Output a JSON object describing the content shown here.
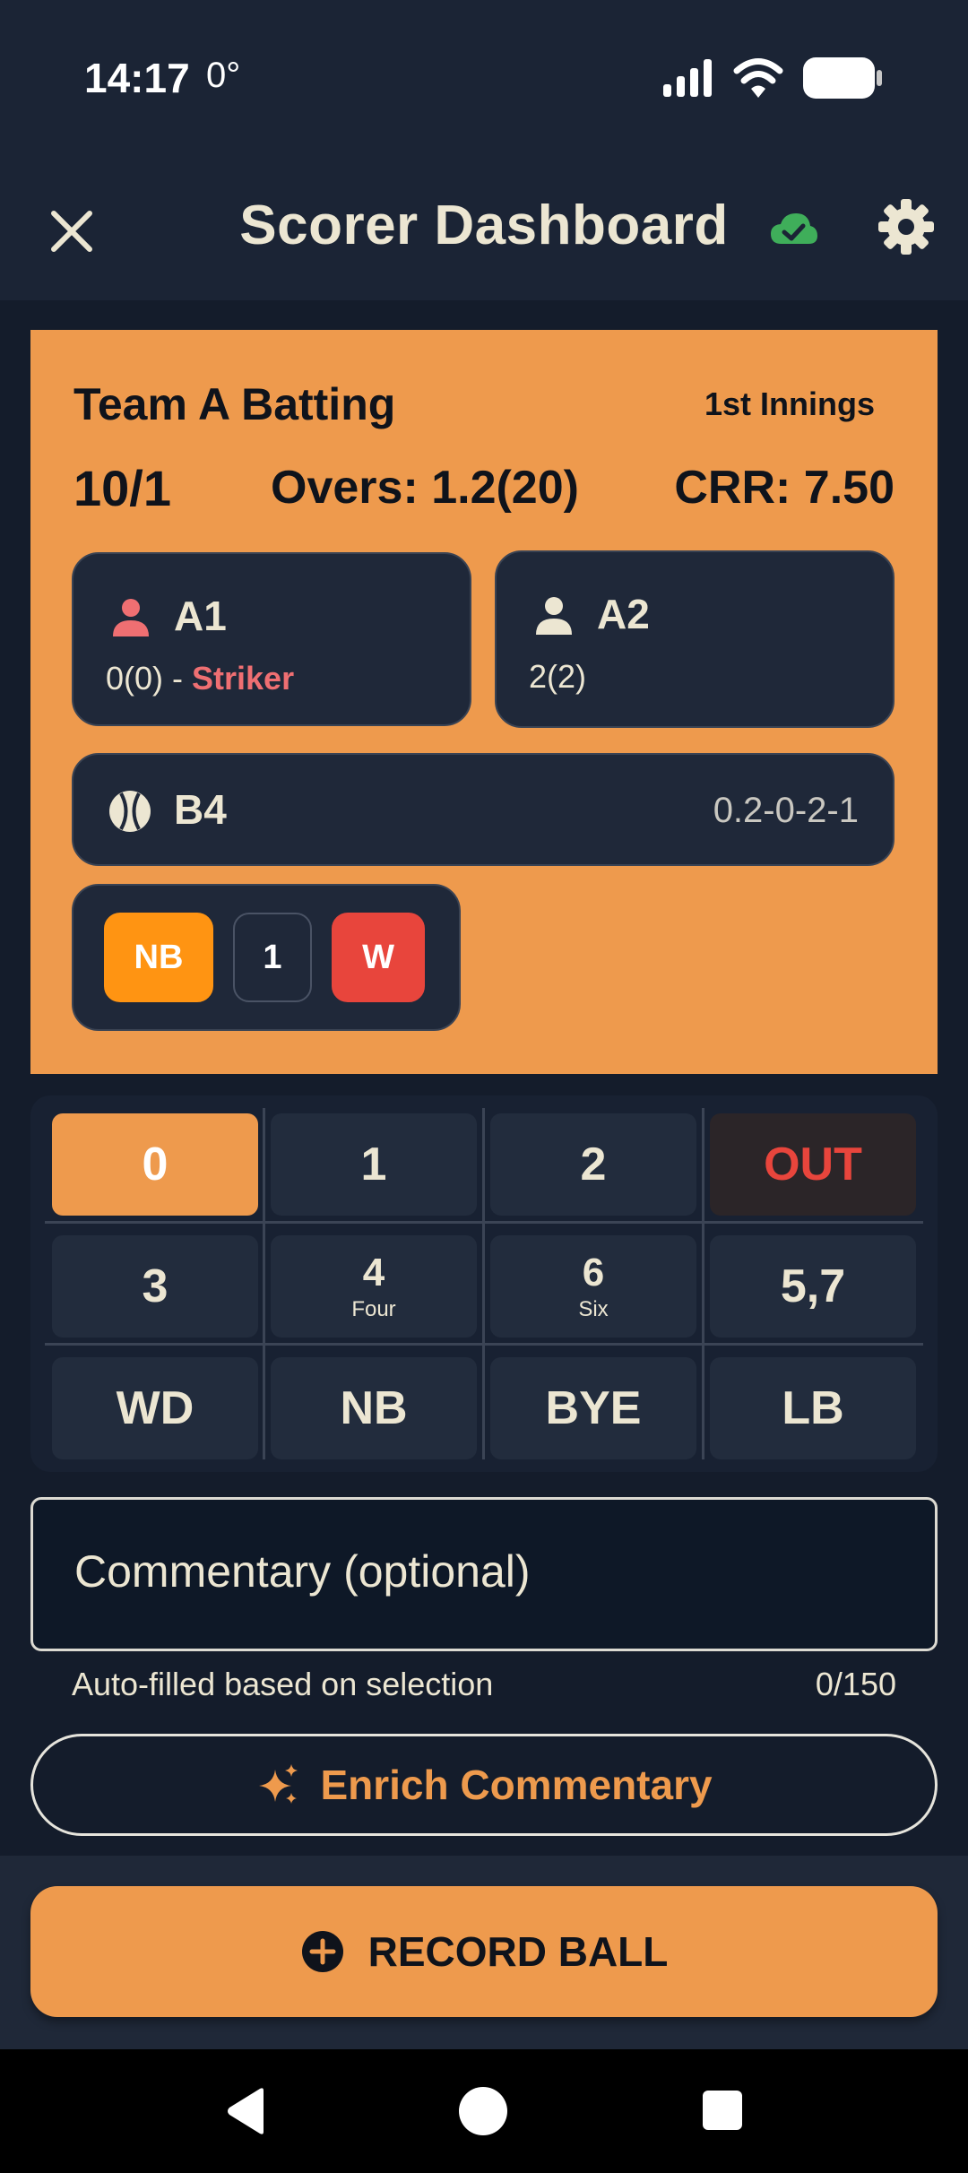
{
  "status": {
    "time": "14:17",
    "temperature": "0°"
  },
  "appbar": {
    "title": "Scorer Dashboard"
  },
  "scorecard": {
    "team_title": "Team A Batting",
    "innings": "1st Innings",
    "score": "10/1",
    "overs": "Overs: 1.2(20)",
    "crr": "CRR: 7.50",
    "batter1": {
      "name": "A1",
      "stat": "0(0) - ",
      "role": "Striker"
    },
    "batter2": {
      "name": "A2",
      "stat": "2(2)"
    },
    "bowler": {
      "name": "B4",
      "figures": "0.2-0-2-1"
    },
    "extras": [
      "NB",
      "1",
      "W"
    ]
  },
  "pad": {
    "keys": [
      {
        "label": "0",
        "sub": ""
      },
      {
        "label": "1",
        "sub": ""
      },
      {
        "label": "2",
        "sub": ""
      },
      {
        "label": "OUT",
        "sub": ""
      },
      {
        "label": "3",
        "sub": ""
      },
      {
        "label": "4",
        "sub": "Four"
      },
      {
        "label": "6",
        "sub": "Six"
      },
      {
        "label": "5,7",
        "sub": ""
      },
      {
        "label": "WD",
        "sub": ""
      },
      {
        "label": "NB",
        "sub": ""
      },
      {
        "label": "BYE",
        "sub": ""
      },
      {
        "label": "LB",
        "sub": ""
      }
    ],
    "selected": "0"
  },
  "commentary": {
    "placeholder": "Commentary (optional)",
    "value": "",
    "helper": "Auto-filled based on selection",
    "counter": "0/150"
  },
  "enrich_label": "Enrich Commentary",
  "record_label": "RECORD BALL",
  "colors": {
    "accent": "#ee9a4d",
    "background": "#1b2435",
    "striker": "#ef6f72",
    "wicket": "#e8453c",
    "noball": "#ff9412",
    "synced": "#3fae5a"
  }
}
